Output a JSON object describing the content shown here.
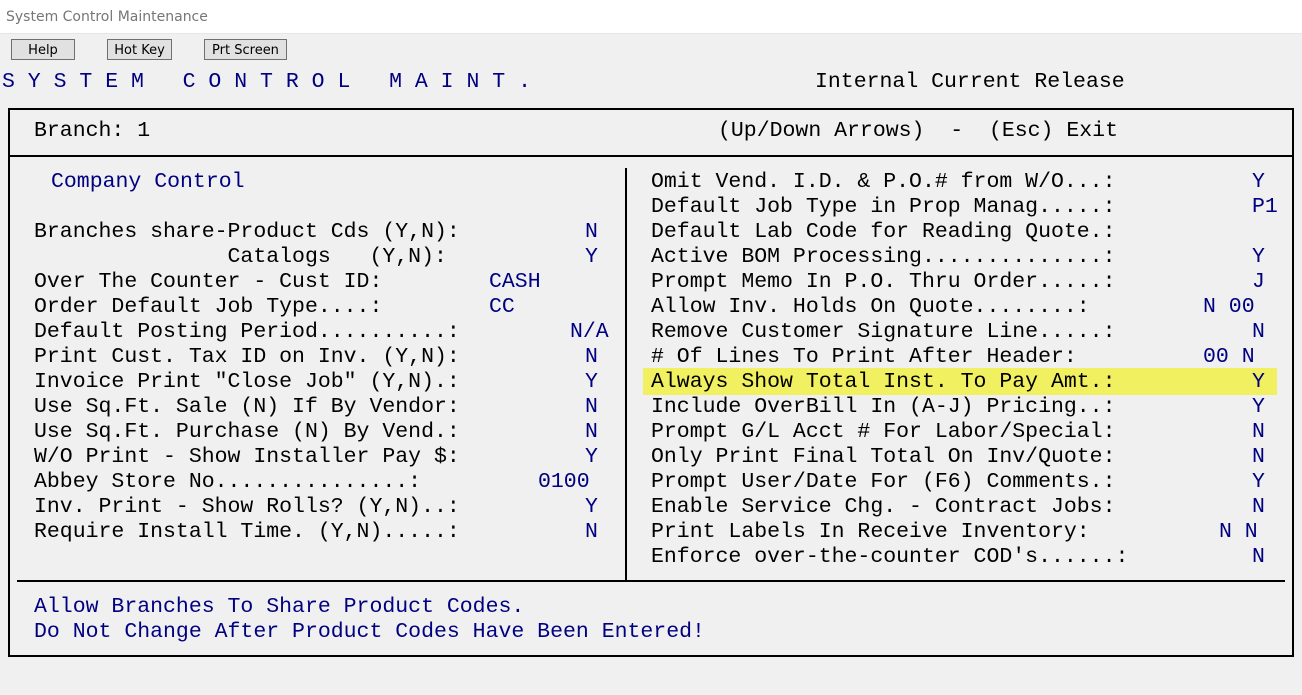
{
  "window": {
    "title": "System Control Maintenance"
  },
  "toolbar": {
    "help_label": "Help",
    "hotkey_label": "Hot Key",
    "prtscreen_label": "Prt Screen"
  },
  "header": {
    "screen_title": "S Y S T E M   C O N T R O L   M A I N T .",
    "release": "Internal Current Release"
  },
  "top_bar": {
    "branch": "Branch: 1",
    "hint": "(Up/Down Arrows)  -  (Esc) Exit"
  },
  "left": {
    "section_title": "Company Control",
    "rows": [
      {
        "label": "Branches share-Product Cds (Y,N):",
        "value": "N"
      },
      {
        "label": "               Catalogs   (Y,N):",
        "value": "Y"
      },
      {
        "label": "Over The Counter - Cust ID:",
        "value": "CASH"
      },
      {
        "label": "Order Default Job Type....:",
        "value": "CC"
      },
      {
        "label": "Default Posting Period..........:",
        "value": "N/A"
      },
      {
        "label": "Print Cust. Tax ID on Inv. (Y,N):",
        "value": "N"
      },
      {
        "label": "Invoice Print \"Close Job\" (Y,N).:",
        "value": "Y"
      },
      {
        "label": "Use Sq.Ft. Sale (N) If By Vendor:",
        "value": "N"
      },
      {
        "label": "Use Sq.Ft. Purchase (N) By Vend.:",
        "value": "N"
      },
      {
        "label": "W/O Print - Show Installer Pay $:",
        "value": "Y"
      },
      {
        "label": "Abbey Store No...............:",
        "value": "0100"
      },
      {
        "label": "Inv. Print - Show Rolls? (Y,N)..:",
        "value": "Y"
      },
      {
        "label": "Require Install Time. (Y,N).....:",
        "value": "N"
      }
    ]
  },
  "right": {
    "rows": [
      {
        "label": "Omit Vend. I.D. & P.O.# from W/O...:",
        "value": "Y"
      },
      {
        "label": "Default Job Type in Prop Manag.....:",
        "value": "P1"
      },
      {
        "label": "Default Lab Code for Reading Quote.:",
        "value": ""
      },
      {
        "label": "Active BOM Processing..............:",
        "value": "Y"
      },
      {
        "label": "Prompt Memo In P.O. Thru Order.....:",
        "value": "J"
      },
      {
        "label": "Allow Inv. Holds On Quote........:",
        "value": "N 00"
      },
      {
        "label": "Remove Customer Signature Line.....:",
        "value": "N"
      },
      {
        "label": "# Of Lines To Print After Header:",
        "value": "00 N"
      },
      {
        "label": "Always Show Total Inst. To Pay Amt.:",
        "value": "Y"
      },
      {
        "label": "Include OverBill In (A-J) Pricing..:",
        "value": "Y"
      },
      {
        "label": "Prompt G/L Acct # For Labor/Special:",
        "value": "N"
      },
      {
        "label": "Only Print Final Total On Inv/Quote:",
        "value": "N"
      },
      {
        "label": "Prompt User/Date For (F6) Comments.:",
        "value": "Y"
      },
      {
        "label": "Enable Service Chg. - Contract Jobs:",
        "value": "N"
      },
      {
        "label": "Print Labels In Receive Inventory:",
        "value": "N N"
      },
      {
        "label": "Enforce over-the-counter COD's......:",
        "value": "N"
      }
    ]
  },
  "help_text": {
    "line1": "Allow Branches To Share Product Codes.",
    "line2": "Do Not Change After Product Codes Have Been Entered!"
  },
  "colors": {
    "highlight": "#f0f060",
    "field_blue": "#000080"
  }
}
